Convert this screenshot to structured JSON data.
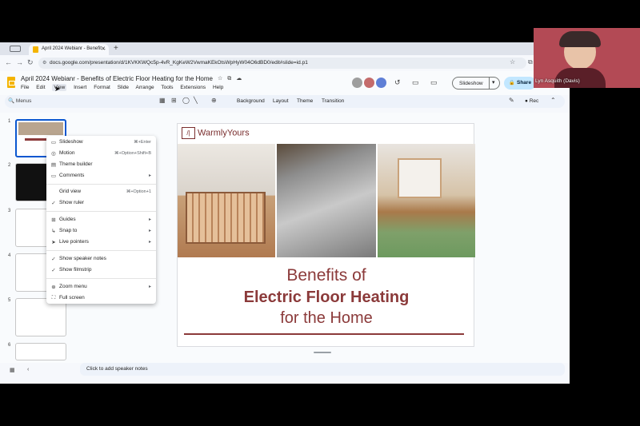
{
  "browser": {
    "tab_title": "April 2024 Webianr - Benefit...",
    "url": "docs.google.com/presentation/d/1KVKKWQc5p-4vR_KgKeW2VwmaKEkOtsWpHyW04O6dBD0/edit#slide=id.p1"
  },
  "doc": {
    "title": "April 2024 Webianr - Benefits of  Electric Floor Heating  for the Home",
    "menus": [
      "File",
      "Edit",
      "View",
      "Insert",
      "Format",
      "Slide",
      "Arrange",
      "Tools",
      "Extensions",
      "Help"
    ],
    "active_menu": "View",
    "slideshow_label": "Slideshow",
    "share_label": "Share"
  },
  "toolbar": {
    "menus_label": "Menus",
    "background_label": "Background",
    "layout_label": "Layout",
    "theme_label": "Theme",
    "transition_label": "Transition",
    "rec_label": "Rec"
  },
  "filmstrip": {
    "slide_numbers": [
      "1",
      "2",
      "3",
      "4",
      "5",
      "6"
    ]
  },
  "view_menu": {
    "items": [
      {
        "icon": "slideshow-icon",
        "label": "Slideshow",
        "shortcut": "⌘+Enter"
      },
      {
        "icon": "motion-icon",
        "label": "Motion",
        "shortcut": "⌘+Option+Shift+B"
      },
      {
        "icon": "theme-builder-icon",
        "label": "Theme builder",
        "shortcut": ""
      },
      {
        "icon": "comments-icon",
        "label": "Comments",
        "shortcut": ""
      },
      {
        "icon": "",
        "label": "Grid view",
        "shortcut": "⌘+Option+1"
      },
      {
        "icon": "check-icon",
        "label": "Show ruler",
        "shortcut": ""
      },
      {
        "icon": "guides-icon",
        "label": "Guides",
        "shortcut": ""
      },
      {
        "icon": "snap-icon",
        "label": "Snap to",
        "shortcut": ""
      },
      {
        "icon": "pointer-icon",
        "label": "Live pointers",
        "shortcut": ""
      },
      {
        "icon": "check-icon",
        "label": "Show speaker notes",
        "shortcut": ""
      },
      {
        "icon": "check-icon",
        "label": "Show filmstrip",
        "shortcut": ""
      },
      {
        "icon": "zoom-icon",
        "label": "Zoom menu",
        "shortcut": ""
      },
      {
        "icon": "fullscreen-icon",
        "label": "Full screen",
        "shortcut": ""
      }
    ]
  },
  "slide": {
    "logo_text": "WarmlyYours",
    "title_line1": "Benefits of",
    "title_line2": "Electric Floor Heating",
    "title_line3": "for the Home"
  },
  "notes": {
    "placeholder": "Click to add speaker notes"
  },
  "webcam": {
    "name": "Lyn Asquith (Davis)"
  },
  "colors": {
    "accent": "#8b3a3a",
    "share_bg": "#c2e7ff",
    "selection": "#0b57d0"
  }
}
